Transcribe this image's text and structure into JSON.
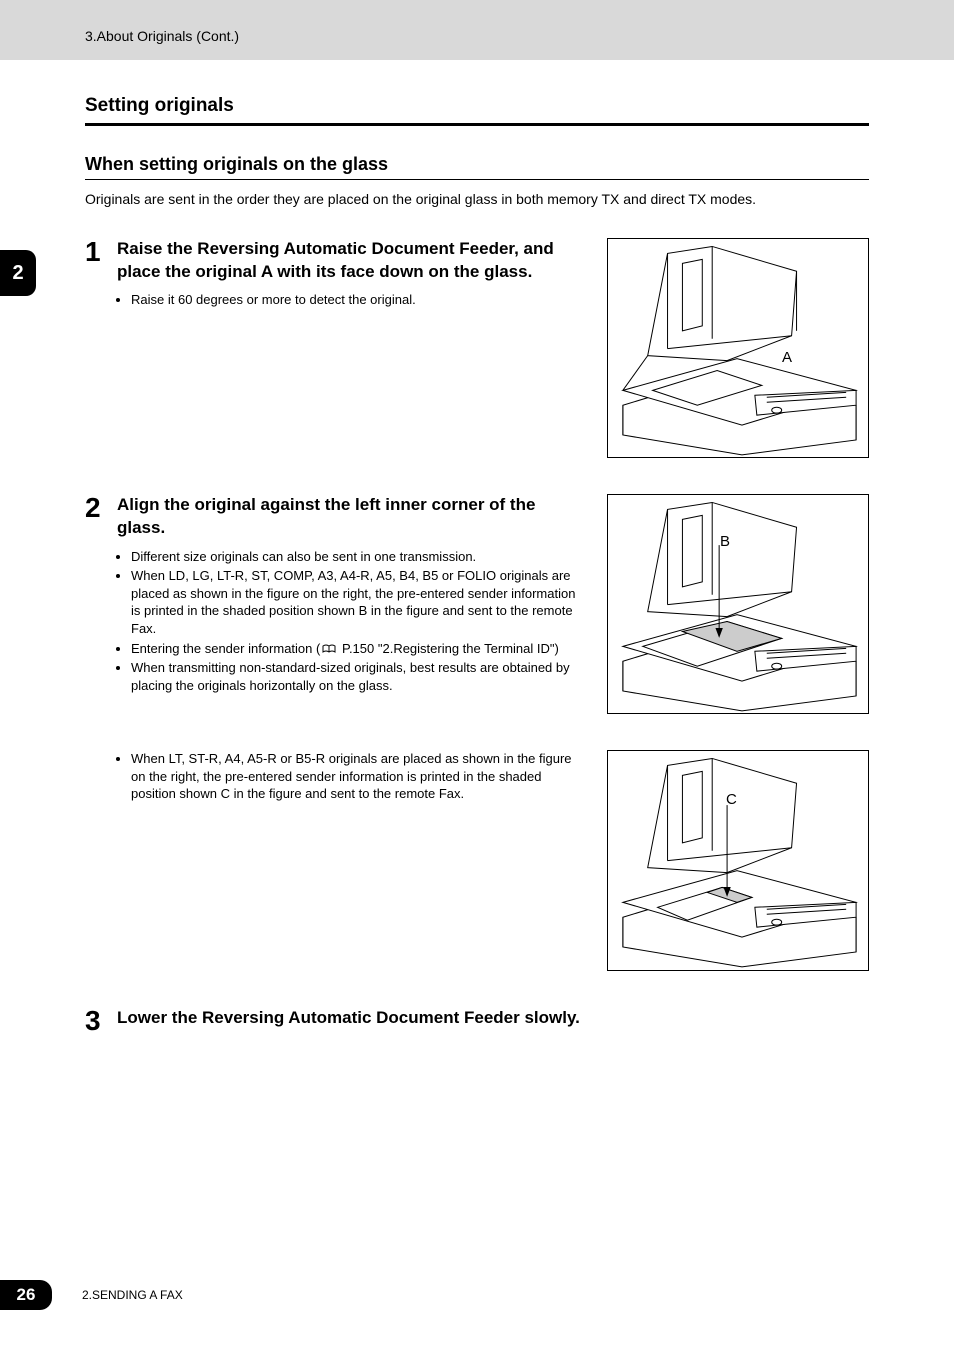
{
  "header": {
    "breadcrumb": "3.About Originals (Cont.)"
  },
  "chapterTab": "2",
  "section": {
    "title": "Setting originals",
    "subTitle": "When setting originals on the glass",
    "intro": "Originals are sent in the order they are placed on the original glass in both memory TX and direct TX modes."
  },
  "steps": {
    "s1": {
      "num": "1",
      "heading": "Raise the Reversing Automatic Document Feeder, and place the original A with its face down on the glass.",
      "bullets": [
        "Raise it 60 degrees or more to detect the original."
      ],
      "label": "A"
    },
    "s2": {
      "num": "2",
      "heading": "Align the original against the left inner corner of the glass.",
      "bullets": [
        "Different size originals can also be sent in one transmission.",
        "When LD, LG, LT-R, ST, COMP, A3, A4-R, A5, B4, B5 or FOLIO originals are placed as shown in the figure on the right, the pre-entered sender information is printed in the shaded position shown B in the figure and sent to the remote Fax.",
        {
          "pre": "Entering the sender information (",
          "ref": "P.150 \"2.Registering the Terminal ID\")"
        },
        "When transmitting non-standard-sized originals, best results are obtained by placing the originals horizontally on the glass."
      ],
      "bullets2": [
        "When LT, ST-R, A4, A5-R or B5-R originals are placed as shown in the figure on the right, the pre-entered sender information is printed in the shaded position shown C in the figure and sent to the remote Fax."
      ],
      "labelB": "B",
      "labelC": "C"
    },
    "s3": {
      "num": "3",
      "heading": "Lower the Reversing Automatic Document Feeder slowly."
    }
  },
  "footer": {
    "pageNumber": "26",
    "chapter": "2.SENDING A FAX"
  }
}
